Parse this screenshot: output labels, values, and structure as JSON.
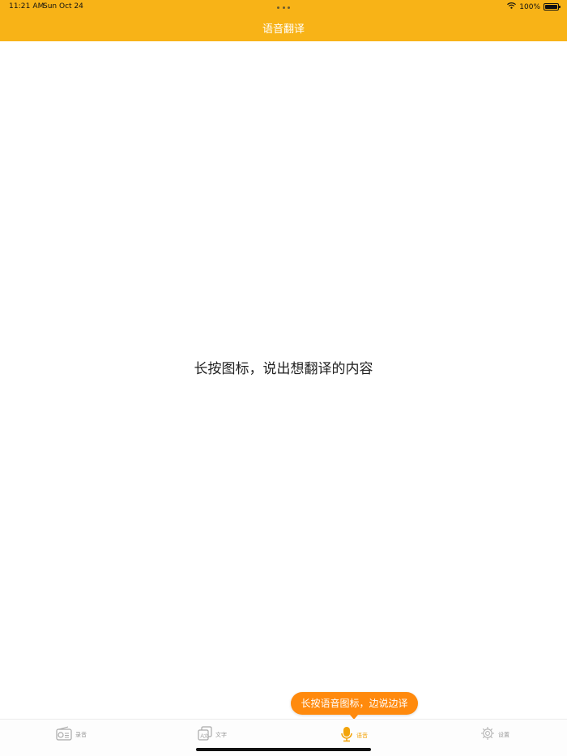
{
  "status_bar": {
    "time": "11:21 AM",
    "date": "Sun Oct 24",
    "battery": "100%",
    "icons": [
      "wifi-icon",
      "battery-icon"
    ]
  },
  "nav": {
    "title": "语音翻译"
  },
  "main": {
    "hint": "长按图标，说出想翻译的内容"
  },
  "tooltip": {
    "text": "长按语音图标，边说边译"
  },
  "tabs": [
    {
      "label": "录音",
      "icon": "radio-icon",
      "active": false
    },
    {
      "label": "文字",
      "icon": "text-translate-icon",
      "active": false
    },
    {
      "label": "语音",
      "icon": "microphone-icon",
      "active": true
    },
    {
      "label": "设置",
      "icon": "gear-icon",
      "active": false
    }
  ],
  "colors": {
    "header": "#f8b317",
    "tooltip": "#ff8a0d",
    "active_tab": "#f2a40c",
    "inactive_tab": "#9a9a9a"
  }
}
